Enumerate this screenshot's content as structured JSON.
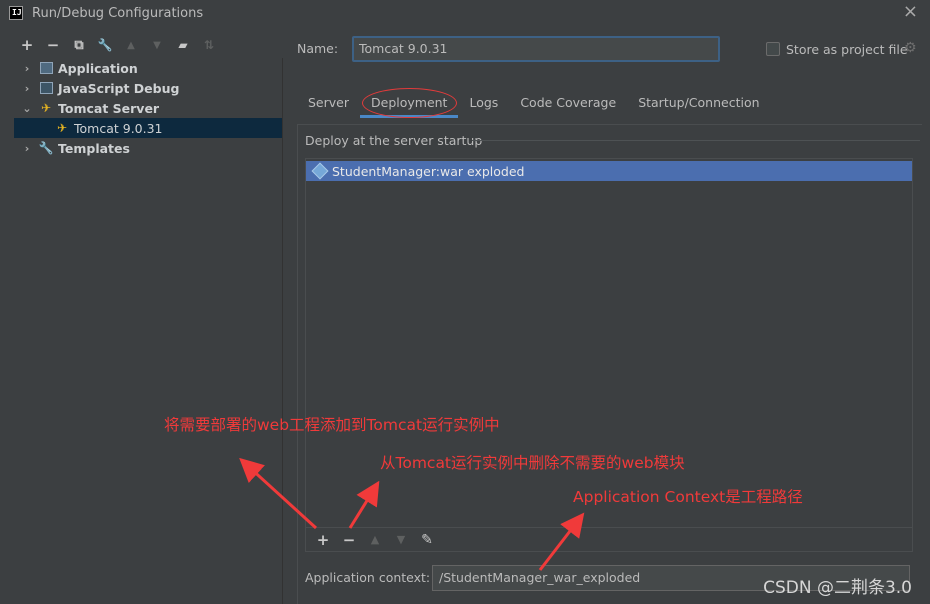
{
  "window": {
    "title": "Run/Debug Configurations",
    "close_icon": "×",
    "logo_text": "IJ"
  },
  "toolbar": {
    "add": "+",
    "remove": "−",
    "copy": "⧉",
    "edit": "🔧",
    "up": "▲",
    "down": "▼",
    "folder": "▰",
    "sort": "⇅"
  },
  "tree": {
    "items": [
      {
        "label": "Application",
        "arrow": "›"
      },
      {
        "label": "JavaScript Debug",
        "arrow": "›"
      },
      {
        "label": "Tomcat Server",
        "arrow": "⌄"
      },
      {
        "label": "Tomcat 9.0.31"
      },
      {
        "label": "Templates",
        "arrow": "›"
      }
    ]
  },
  "form": {
    "name_label": "Name:",
    "name_value": "Tomcat 9.0.31",
    "store_label": "Store as project file"
  },
  "tabs": [
    "Server",
    "Deployment",
    "Logs",
    "Code Coverage",
    "Startup/Connection"
  ],
  "active_tab": "Deployment",
  "deploy": {
    "header": "Deploy at the server startup",
    "items": [
      "StudentManager:war exploded"
    ],
    "toolbar": {
      "add": "+",
      "remove": "−",
      "up": "▲",
      "down": "▼",
      "edit": "✎"
    }
  },
  "context": {
    "label": "Application context:",
    "value": "/StudentManager_war_exploded"
  },
  "annotations": {
    "add_hint": "将需要部署的web工程添加到Tomcat运行实例中",
    "remove_hint": "从Tomcat运行实例中删除不需要的web模块",
    "context_hint": "Application Context是工程路径"
  },
  "watermark": "CSDN @二荆条3.0",
  "colors": {
    "accent": "#4a88c7",
    "selection": "#4b6eaf",
    "annotation": "#f03a3a"
  }
}
